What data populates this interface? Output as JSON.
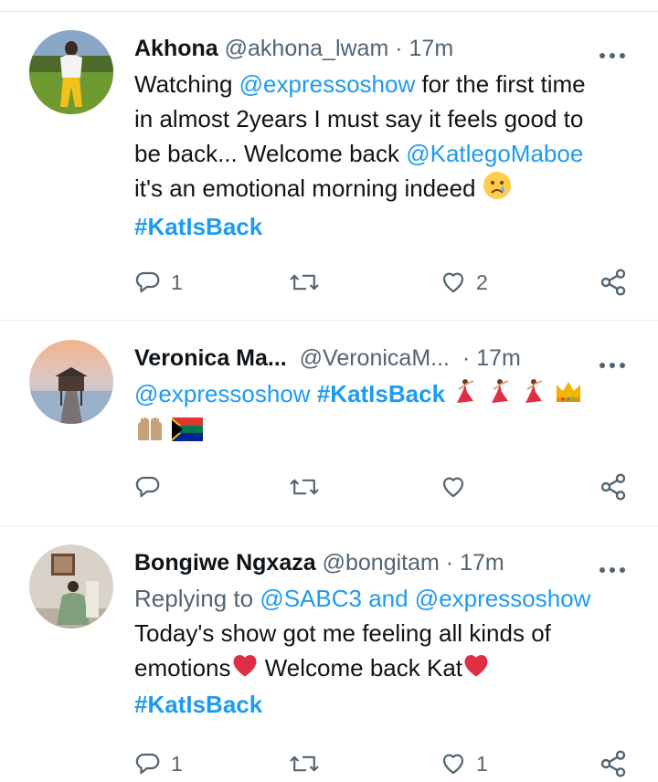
{
  "tweets": [
    {
      "name": "Akhona",
      "handle": "@akhona_lwam",
      "sep": "·",
      "time": "17m",
      "lines": [
        {
          "pre": "Watching ",
          "mention": "@expressoshow",
          "post": " for the first time"
        },
        {
          "text": "in almost 2years I must say it feels good to"
        },
        {
          "pre": "be back... Welcome back ",
          "mention": "@KatlegoMaboe"
        },
        {
          "text": "it's an emotional morning indeed"
        },
        {
          "hashtag": "#KatIsBack"
        }
      ],
      "reply_count": "1",
      "retweet_count": "",
      "like_count": "2"
    },
    {
      "name": "Veronica Ma...",
      "handle": "@VeronicaM...",
      "sep": "·",
      "time": "17m",
      "line1_mention": "@expressoshow",
      "line1_hashtag": "#KatIsBack",
      "reply_count": "",
      "retweet_count": "",
      "like_count": ""
    },
    {
      "name": "Bongiwe Ngxaza",
      "handle": "@bongitam",
      "sep": "·",
      "time": "17m",
      "reply_prefix": "Replying to ",
      "reply_mention_1": "@SABC3",
      "reply_and": " and ",
      "reply_mention_2": "@expressoshow",
      "line1": "Today's show got me feeling all kinds of",
      "line2a": "emotions",
      "line2b": " Welcome back Kat",
      "hashtag": "#KatIsBack",
      "reply_count": "1",
      "retweet_count": "",
      "like_count": "1"
    }
  ],
  "icons": [
    "more-icon",
    "reply-icon",
    "retweet-icon",
    "like-icon",
    "share-icon",
    "crying-face-emoji",
    "dancer-emoji",
    "crown-emoji",
    "raising-hands-emoji",
    "south-africa-flag-emoji",
    "red-heart-emoji"
  ],
  "colors": {
    "link": "#1d9bf0",
    "secondary": "#536471",
    "text": "#0f1419",
    "divider": "#e6e9ec"
  }
}
